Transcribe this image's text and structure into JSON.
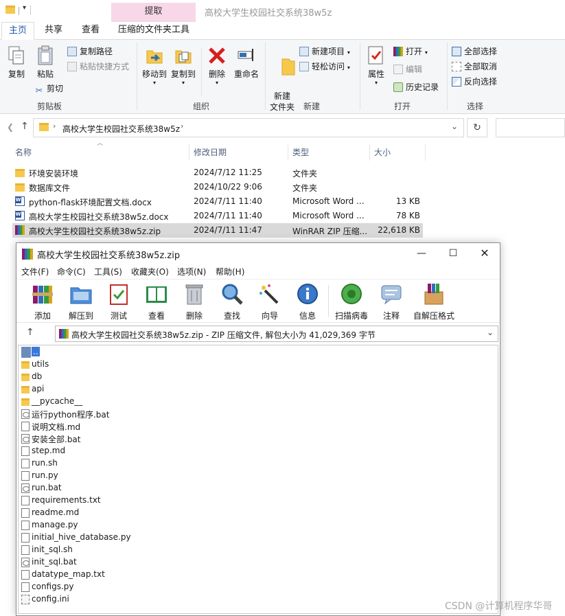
{
  "explorer": {
    "window_title": "高校大学生校园社交系统38w5z",
    "contextual_tab": "提取",
    "tabs": [
      "主页",
      "共享",
      "查看",
      "压缩的文件夹工具"
    ],
    "ribbon": {
      "clipboard": {
        "copy": "复制",
        "paste": "粘贴",
        "copy_path": "复制路径",
        "paste_shortcut": "粘贴快捷方式",
        "cut": "剪切",
        "label": "剪贴板"
      },
      "organize": {
        "move_to": "移动到",
        "copy_to": "复制到",
        "delete": "删除",
        "rename": "重命名",
        "label": "组织"
      },
      "new": {
        "new_folder": "新建\n文件夹",
        "new_item": "新建项目",
        "easy_access": "轻松访问",
        "label": "新建"
      },
      "open": {
        "properties": "属性",
        "open": "打开",
        "edit": "编辑",
        "history": "历史记录",
        "label": "打开"
      },
      "select": {
        "select_all": "全部选择",
        "select_none": "全部取消",
        "invert": "反向选择",
        "label": "选择"
      }
    },
    "address": {
      "path": "高校大学生校园社交系统38w5z"
    },
    "columns": {
      "name": "名称",
      "modified": "修改日期",
      "type": "类型",
      "size": "大小"
    },
    "files": [
      {
        "name": "环境安装环境",
        "modified": "2024/7/12 11:25",
        "type": "文件夹",
        "size": "",
        "icon": "folder"
      },
      {
        "name": "数据库文件",
        "modified": "2024/10/22 9:06",
        "type": "文件夹",
        "size": "",
        "icon": "folder"
      },
      {
        "name": "python-flask环境配置文档.docx",
        "modified": "2024/7/11 11:40",
        "type": "Microsoft Word ...",
        "size": "13 KB",
        "icon": "word"
      },
      {
        "name": "高校大学生校园社交系统38w5z.docx",
        "modified": "2024/7/11 11:40",
        "type": "Microsoft Word ...",
        "size": "78 KB",
        "icon": "word"
      },
      {
        "name": "高校大学生校园社交系统38w5z.zip",
        "modified": "2024/7/11 11:47",
        "type": "WinRAR ZIP 压缩...",
        "size": "22,618 KB",
        "icon": "rar"
      }
    ]
  },
  "winrar": {
    "title": "高校大学生校园社交系统38w5z.zip",
    "menu": [
      "文件(F)",
      "命令(C)",
      "工具(S)",
      "收藏夹(O)",
      "选项(N)",
      "帮助(H)"
    ],
    "tools": [
      "添加",
      "解压到",
      "测试",
      "查看",
      "删除",
      "查找",
      "向导",
      "信息",
      "扫描病毒",
      "注释",
      "自解压格式"
    ],
    "path_text": "高校大学生校园社交系统38w5z.zip - ZIP 压缩文件, 解包大小为 41,029,369 字节",
    "items": [
      {
        "name": "..",
        "icon": "up"
      },
      {
        "name": "utils",
        "icon": "folder"
      },
      {
        "name": "db",
        "icon": "folder"
      },
      {
        "name": "api",
        "icon": "folder"
      },
      {
        "name": "__pycache__",
        "icon": "folder"
      },
      {
        "name": "运行python程序.bat",
        "icon": "bat"
      },
      {
        "name": "说明文档.md",
        "icon": "file"
      },
      {
        "name": "安装全部.bat",
        "icon": "bat"
      },
      {
        "name": "step.md",
        "icon": "file"
      },
      {
        "name": "run.sh",
        "icon": "file"
      },
      {
        "name": "run.py",
        "icon": "file"
      },
      {
        "name": "run.bat",
        "icon": "bat"
      },
      {
        "name": "requirements.txt",
        "icon": "file"
      },
      {
        "name": "readme.md",
        "icon": "file"
      },
      {
        "name": "manage.py",
        "icon": "file"
      },
      {
        "name": "initial_hive_database.py",
        "icon": "file"
      },
      {
        "name": "init_sql.sh",
        "icon": "file"
      },
      {
        "name": "init_sql.bat",
        "icon": "bat"
      },
      {
        "name": "datatype_map.txt",
        "icon": "file"
      },
      {
        "name": "configs.py",
        "icon": "file"
      },
      {
        "name": "config.ini",
        "icon": "ini"
      }
    ]
  },
  "watermark": "CSDN @计算机程序华哥"
}
